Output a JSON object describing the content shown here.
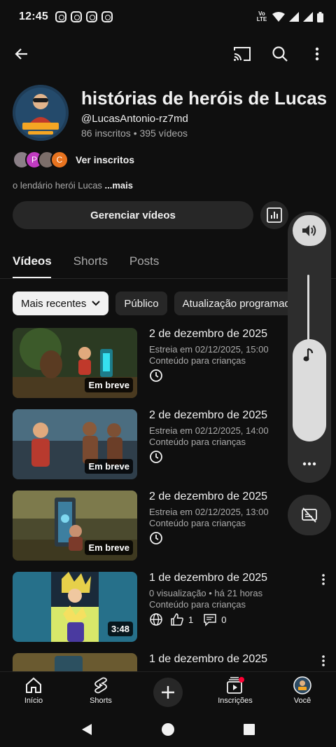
{
  "status_bar": {
    "time": "12:45",
    "network": "Vo LTE",
    "app_icons": [
      "instagram-icon",
      "instagram-icon",
      "instagram-icon",
      "instagram-icon"
    ],
    "system_icons": [
      "wifi-icon",
      "signal-icon",
      "signal-icon",
      "battery-icon"
    ]
  },
  "app_bar": {
    "icons": [
      "back-arrow-icon",
      "cast-icon",
      "search-icon",
      "more-vertical-icon"
    ]
  },
  "channel": {
    "name": "histórias de heróis de Lucas",
    "handle": "@LucasAntonio-rz7md",
    "stats": "86 inscritos • 395 vídeos",
    "subscriber_avatars": [
      "",
      "P",
      "",
      "C"
    ],
    "see_subscribers": "Ver inscritos",
    "description": "o lendário herói Lucas ",
    "more": "...mais",
    "logo_text": "HISTÓRIAS DE HERÓI"
  },
  "actions": {
    "manage_label": "Gerenciar vídeos"
  },
  "tabs": [
    {
      "label": "Vídeos",
      "active": true
    },
    {
      "label": "Shorts",
      "active": false
    },
    {
      "label": "Posts",
      "active": false
    }
  ],
  "chips": [
    {
      "label": "Mais recentes",
      "active": true
    },
    {
      "label": "Público",
      "active": false
    },
    {
      "label": "Atualização programada",
      "active": false
    }
  ],
  "videos": [
    {
      "title": "2 de dezembro de 2025",
      "line1": "Estreia em 02/12/2025, 15:00",
      "line2": "Conteúdo para crianças",
      "badge": "Em breve"
    },
    {
      "title": "2 de dezembro de 2025",
      "line1": "Estreia em 02/12/2025, 14:00",
      "line2": "Conteúdo para crianças",
      "badge": "Em breve"
    },
    {
      "title": "2 de dezembro de 2025",
      "line1": "Estreia em 02/12/2025, 13:00",
      "line2": "Conteúdo para crianças",
      "badge": "Em breve"
    },
    {
      "title": "1 de dezembro de 2025",
      "line1": "0 visualização • há 21 horas",
      "line2": "Conteúdo para crianças",
      "badge": "3:48",
      "likes": "1",
      "comments": "0"
    },
    {
      "title": "1 de dezembro de 2025"
    }
  ],
  "bottom_nav": [
    {
      "label": "Início"
    },
    {
      "label": "Shorts"
    },
    {
      "label": "Inscrições"
    },
    {
      "label": "Você"
    }
  ],
  "colors": {
    "background": "#0f0f0f",
    "surface": "#272727",
    "text_primary": "#f1f1f1",
    "text_secondary": "#aaaaaa",
    "notification": "#ff0033"
  }
}
